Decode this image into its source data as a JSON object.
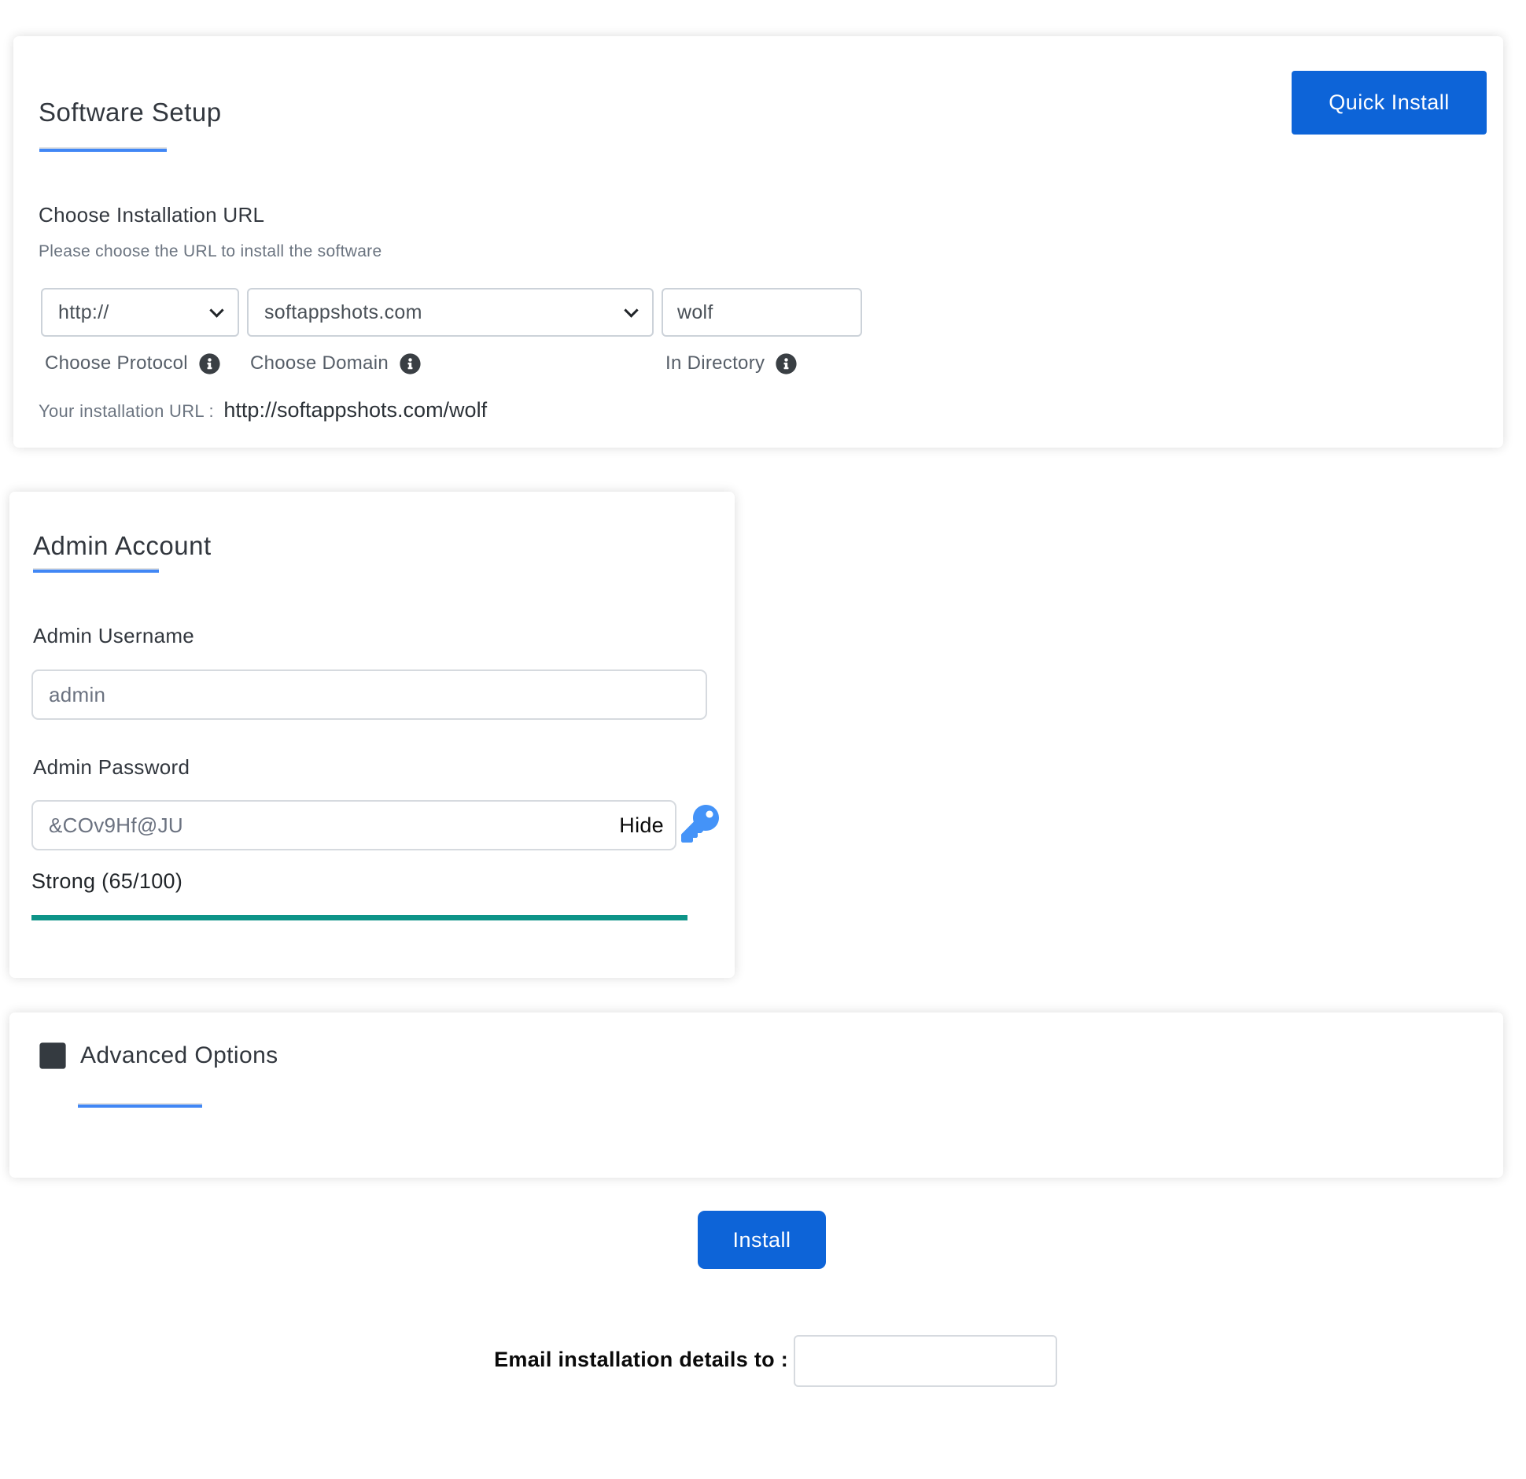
{
  "software_setup": {
    "title": "Software Setup",
    "quick_install_label": "Quick Install",
    "section_title": "Choose Installation URL",
    "section_subtitle": "Please choose the URL to install the software",
    "protocol": {
      "value": "http://",
      "label": "Choose Protocol"
    },
    "domain": {
      "value": "softappshots.com",
      "label": "Choose Domain"
    },
    "directory": {
      "value": "wolf",
      "label": "In Directory"
    },
    "installation_url_label": "Your installation URL :",
    "installation_url_value": "http://softappshots.com/wolf"
  },
  "admin_account": {
    "title": "Admin Account",
    "username_label": "Admin Username",
    "username_value": "admin",
    "password_label": "Admin Password",
    "password_value": "&COv9Hf@JU",
    "hide_label": "Hide",
    "strength_text": "Strong (65/100)",
    "strength_bar_fill_percent": 100
  },
  "advanced_options": {
    "title": "Advanced Options"
  },
  "footer": {
    "install_label": "Install",
    "email_label": "Email installation details to :",
    "email_value": ""
  },
  "icons": {
    "protocol_info": "info-circle",
    "domain_info": "info-circle",
    "directory_info": "info-circle",
    "password_key": "key",
    "advanced_plus": "plus-square",
    "select_chevron": "chevron-down"
  },
  "colors": {
    "primary_button_blue": "#0d64d8",
    "accent_underline_blue": "#4187f5",
    "key_icon_blue": "#4493f8",
    "strength_bar_teal": "#0d9488",
    "icon_dark": "#3a3f44",
    "heading_text": "#32373e",
    "muted_text": "#6b7480"
  }
}
